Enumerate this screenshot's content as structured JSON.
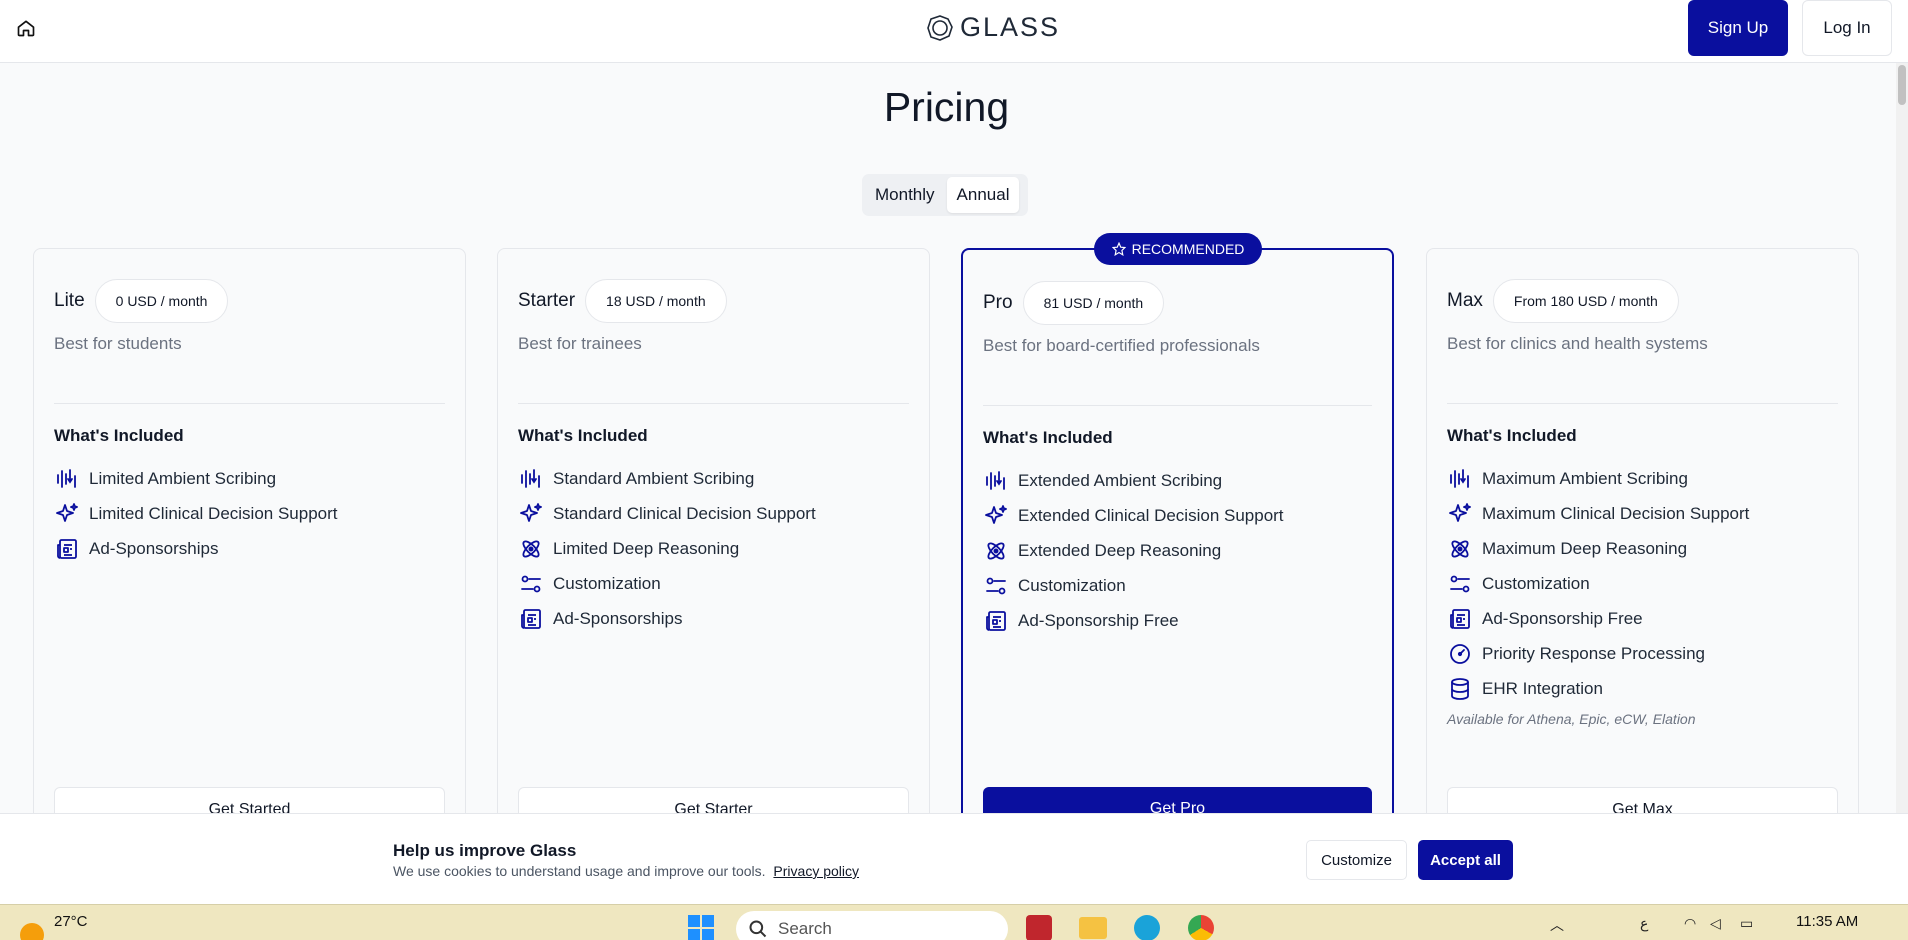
{
  "header": {
    "logo_text": "GLASS",
    "signup_label": "Sign Up",
    "login_label": "Log In"
  },
  "page_title": "Pricing",
  "billing_toggle": {
    "options": [
      "Monthly",
      "Annual"
    ],
    "selected": "Annual"
  },
  "recommended_badge": "RECOMMENDED",
  "plans": [
    {
      "name": "Lite",
      "price": "0 USD / month",
      "description": "Best for students",
      "included_title": "What's Included",
      "features": [
        {
          "icon": "ambient-scribing-icon",
          "label": "Limited Ambient Scribing"
        },
        {
          "icon": "sparkle-icon",
          "label": "Limited Clinical Decision Support"
        },
        {
          "icon": "newspaper-icon",
          "label": "Ad-Sponsorships"
        }
      ],
      "cta": "Get Started"
    },
    {
      "name": "Starter",
      "price": "18 USD / month",
      "description": "Best for trainees",
      "included_title": "What's Included",
      "features": [
        {
          "icon": "ambient-scribing-icon",
          "label": "Standard Ambient Scribing"
        },
        {
          "icon": "sparkle-icon",
          "label": "Standard Clinical Decision Support"
        },
        {
          "icon": "atom-icon",
          "label": "Limited Deep Reasoning"
        },
        {
          "icon": "sliders-icon",
          "label": "Customization"
        },
        {
          "icon": "newspaper-icon",
          "label": "Ad-Sponsorships"
        }
      ],
      "cta": "Get Starter"
    },
    {
      "name": "Pro",
      "price": "81 USD / month",
      "description": "Best for board-certified professionals",
      "included_title": "What's Included",
      "features": [
        {
          "icon": "ambient-scribing-icon",
          "label": "Extended Ambient Scribing"
        },
        {
          "icon": "sparkle-icon",
          "label": "Extended Clinical Decision Support"
        },
        {
          "icon": "atom-icon",
          "label": "Extended Deep Reasoning"
        },
        {
          "icon": "sliders-icon",
          "label": "Customization"
        },
        {
          "icon": "newspaper-icon",
          "label": "Ad-Sponsorship Free"
        }
      ],
      "cta": "Get Pro"
    },
    {
      "name": "Max",
      "price": "From 180 USD / month",
      "description": "Best for clinics and health systems",
      "included_title": "What's Included",
      "features": [
        {
          "icon": "ambient-scribing-icon",
          "label": "Maximum Ambient Scribing"
        },
        {
          "icon": "sparkle-icon",
          "label": "Maximum Clinical Decision Support"
        },
        {
          "icon": "atom-icon",
          "label": "Maximum Deep Reasoning"
        },
        {
          "icon": "sliders-icon",
          "label": "Customization"
        },
        {
          "icon": "newspaper-icon",
          "label": "Ad-Sponsorship Free"
        },
        {
          "icon": "gauge-icon",
          "label": "Priority Response Processing"
        },
        {
          "icon": "database-icon",
          "label": "EHR Integration"
        }
      ],
      "note": "Available for Athena, Epic, eCW, Elation",
      "cta": "Get Max"
    }
  ],
  "cookie_banner": {
    "title": "Help us improve Glass",
    "text": "We use cookies to understand usage and improve our tools.",
    "link": "Privacy policy",
    "customize_label": "Customize",
    "accept_label": "Accept all"
  },
  "taskbar": {
    "temperature": "27°C",
    "search_placeholder": "Search",
    "time": "11:35 AM",
    "lang": "ع"
  },
  "colors": {
    "brand": "#0a0f9e",
    "muted_text": "#6b7280",
    "border": "#e5e7eb"
  }
}
